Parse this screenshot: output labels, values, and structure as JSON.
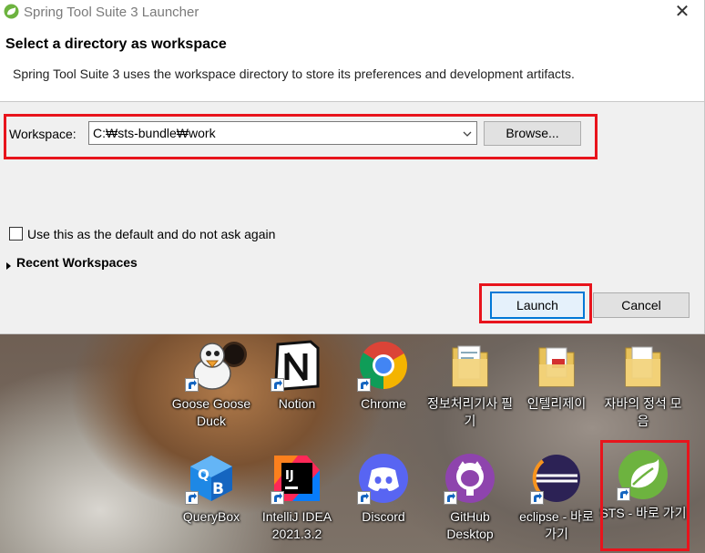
{
  "window": {
    "title": "Spring Tool Suite 3 Launcher",
    "close_glyph": "✕",
    "app_icon": "spring-leaf-icon"
  },
  "header": {
    "heading": "Select a directory as workspace",
    "description": "Spring Tool Suite 3 uses the workspace directory to store its preferences and development artifacts."
  },
  "workspace": {
    "label": "Workspace:",
    "value": "C:₩sts-bundle₩work",
    "browse_label": "Browse..."
  },
  "default_checkbox": {
    "label": "Use this as the default and do not ask again",
    "checked": false
  },
  "recent": {
    "label": "Recent Workspaces",
    "expanded": false
  },
  "buttons": {
    "launch": "Launch",
    "cancel": "Cancel"
  },
  "colors": {
    "highlight_red": "#e8141c",
    "focus_blue": "#0078d7",
    "spring_green": "#6db33f"
  },
  "desktop_icons": [
    {
      "label": "Goose Goose Duck",
      "icon": "goose-goose-duck-icon"
    },
    {
      "label": "Notion",
      "icon": "notion-icon"
    },
    {
      "label": "Chrome",
      "icon": "chrome-icon"
    },
    {
      "label": "정보처리기사 필기",
      "icon": "folder-icon"
    },
    {
      "label": "인텔리제이",
      "icon": "folder-pdf-icon"
    },
    {
      "label": "자바의 정석 모음",
      "icon": "folder-icon"
    },
    {
      "label": "QueryBox",
      "icon": "querybox-icon"
    },
    {
      "label": "IntelliJ IDEA 2021.3.2",
      "icon": "intellij-idea-icon"
    },
    {
      "label": "Discord",
      "icon": "discord-icon"
    },
    {
      "label": "GitHub Desktop",
      "icon": "github-desktop-icon"
    },
    {
      "label": "eclipse - 바로 가기",
      "icon": "eclipse-icon"
    },
    {
      "label": "STS - 바로 가기",
      "icon": "sts-icon"
    }
  ]
}
